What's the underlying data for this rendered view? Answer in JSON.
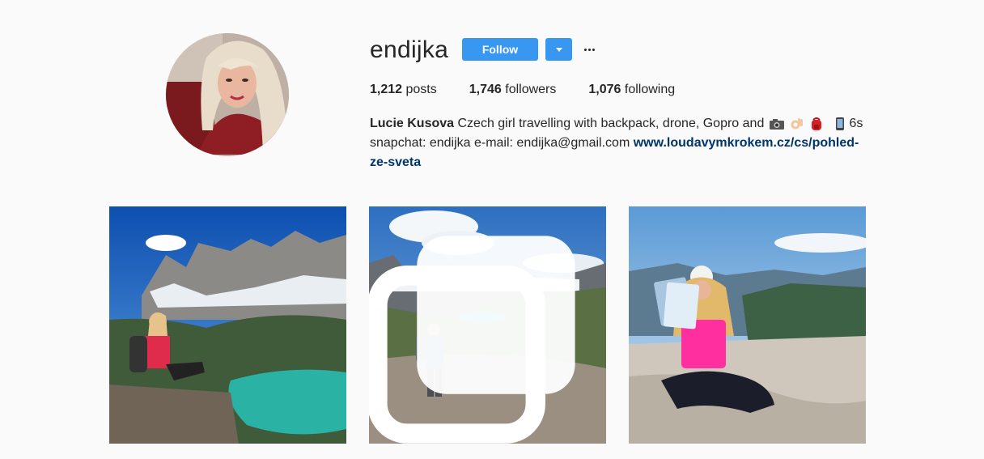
{
  "profile": {
    "username": "endijka",
    "follow_label": "Follow",
    "stats": {
      "posts_count": "1,212",
      "posts_label": "posts",
      "followers_count": "1,746",
      "followers_label": "followers",
      "following_count": "1,076",
      "following_label": "following"
    },
    "bio": {
      "full_name": "Lucie Kusova",
      "text_1": "Czech girl travelling with backpack, drone, Gopro and",
      "text_2": "6s",
      "text_3": "snapchat: endijka e-mail: endijka@gmail.com",
      "link": "www.loudavymkrokem.cz/cs/pohled-ze-sveta"
    }
  },
  "icons": {
    "camera": "camera-icon",
    "ok_hand": "ok-hand-icon",
    "backpack": "backpack-icon",
    "phone": "mobile-phone-icon",
    "dropdown": "chevron-down-icon",
    "more": "more-options-icon",
    "carousel": "multiple-photos-icon"
  },
  "colors": {
    "accent": "#3897f0",
    "link": "#003569",
    "text": "#262626",
    "background": "#fafafa"
  },
  "posts": [
    {
      "type": "photo",
      "multiple": false
    },
    {
      "type": "photo",
      "multiple": true
    },
    {
      "type": "photo",
      "multiple": false
    }
  ]
}
